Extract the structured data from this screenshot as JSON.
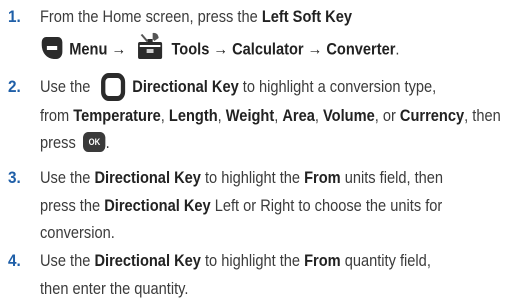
{
  "steps": [
    {
      "number": "1.",
      "line1": {
        "t1": "From the Home screen, press the ",
        "b1": "Left Soft Key"
      },
      "line2": {
        "b_menu": "Menu",
        "arrow1": " → ",
        "b_tools": "Tools",
        "arrow2": " → ",
        "b_calc": "Calculator",
        "arrow3": " → ",
        "b_conv": "Converter",
        "t_end": "."
      },
      "icons": [
        "left-soft-key-icon",
        "tools-icon"
      ]
    },
    {
      "number": "2.",
      "line1": {
        "t1": "Use the ",
        "b1": "Directional Key",
        "t2": " to highlight a conversion type,"
      },
      "line2": {
        "t1": "from ",
        "b1": "Temperature",
        "s1": ", ",
        "b2": "Length",
        "s2": ", ",
        "b3": "Weight",
        "s3": ", ",
        "b4": "Area",
        "s4": ", ",
        "b5": "Volume",
        "s5": ", or ",
        "b6": "Currency",
        "t2": ", then"
      },
      "line3": {
        "t1": "press "
      },
      "ok_label": "OK",
      "icons": [
        "directional-key-icon",
        "ok-key-icon"
      ]
    },
    {
      "number": "3.",
      "line1": {
        "t1": "Use the ",
        "b1": "Directional Key",
        "t2": " to highlight the ",
        "b2": "From",
        "t3": " units field, then"
      },
      "line2": {
        "t1": "press the ",
        "b1": "Directional Key",
        "t2": " Left or Right to choose the units for"
      },
      "line3": {
        "t1": "conversion."
      }
    },
    {
      "number": "4.",
      "line1": {
        "t1": "Use the ",
        "b1": "Directional Key",
        "t2": " to highlight the ",
        "b2": "From",
        "t3": " quantity field,"
      },
      "line2": {
        "t1": "then enter the quantity."
      }
    }
  ],
  "colors": {
    "number": "#1f5fa8",
    "text": "#3b3b3b",
    "icon": "#2b2b2b"
  }
}
